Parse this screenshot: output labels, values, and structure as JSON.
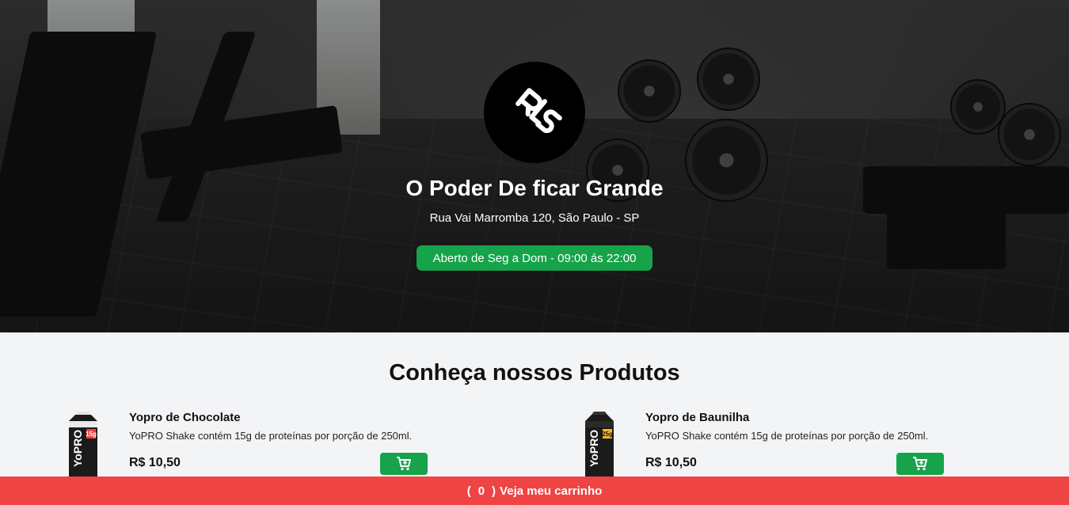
{
  "hero": {
    "title": "O Poder De ficar Grande",
    "address": "Rua Vai Marromba 120, São Paulo - SP",
    "hours": "Aberto de Seg a Dom - 09:00 ás 22:00",
    "logo_icon": "rls-logo-icon"
  },
  "products_section": {
    "title": "Conheça nossos Produtos",
    "items": [
      {
        "name": "Yopro de Chocolate",
        "description": "YoPRO Shake contém 15g de proteínas por porção de 250ml.",
        "price": "R$ 10,50",
        "cart_icon": "add-to-cart-icon",
        "accent": "#ef4444"
      },
      {
        "name": "Yopro de Baunilha",
        "description": "YoPRO Shake contém 15g de proteínas por porção de 250ml.",
        "price": "R$ 10,50",
        "cart_icon": "add-to-cart-icon",
        "accent": "#f5b82e"
      }
    ]
  },
  "cart_bar": {
    "open_paren": "(",
    "count": "0",
    "close_paren": ")",
    "label": "Veja meu carrinho"
  },
  "colors": {
    "green": "#16a34a",
    "red": "#ef4444",
    "background": "#f3f4f6"
  }
}
